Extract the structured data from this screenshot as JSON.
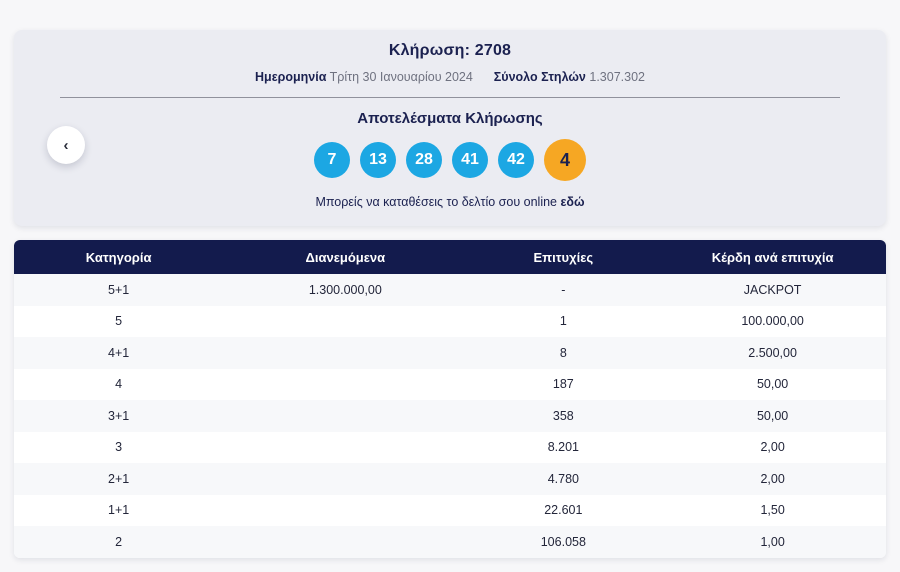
{
  "draw": {
    "title": "Κλήρωση: 2708",
    "date_label": "Ημερομηνία",
    "date_value": "Τρίτη 30 Ιανουαρίου 2024",
    "columns_label": "Σύνολο Στηλών",
    "columns_value": "1.307.302",
    "results_title": "Αποτελέσματα Κλήρωσης",
    "numbers": [
      "7",
      "13",
      "28",
      "41",
      "42"
    ],
    "bonus_number": "4",
    "cta_text": "Μπορείς να καταθέσεις το δελτίο σου online",
    "cta_link_label": "εδώ",
    "prev_arrow": "‹"
  },
  "table": {
    "headers": [
      "Κατηγορία",
      "Διανεμόμενα",
      "Επιτυχίες",
      "Κέρδη ανά επιτυχία"
    ],
    "rows": [
      [
        "5+1",
        "1.300.000,00",
        "-",
        "JACKPOT"
      ],
      [
        "5",
        "",
        "1",
        "100.000,00"
      ],
      [
        "4+1",
        "",
        "8",
        "2.500,00"
      ],
      [
        "4",
        "",
        "187",
        "50,00"
      ],
      [
        "3+1",
        "",
        "358",
        "50,00"
      ],
      [
        "3",
        "",
        "8.201",
        "2,00"
      ],
      [
        "2+1",
        "",
        "4.780",
        "2,00"
      ],
      [
        "1+1",
        "",
        "22.601",
        "1,50"
      ],
      [
        "2",
        "",
        "106.058",
        "1,00"
      ]
    ]
  },
  "colors": {
    "main_ball": "#1ca7e3",
    "bonus_ball": "#f6a723",
    "header_bar": "#131b4d",
    "navy_text": "#1b2150",
    "card_bg": "#ebecf2"
  }
}
